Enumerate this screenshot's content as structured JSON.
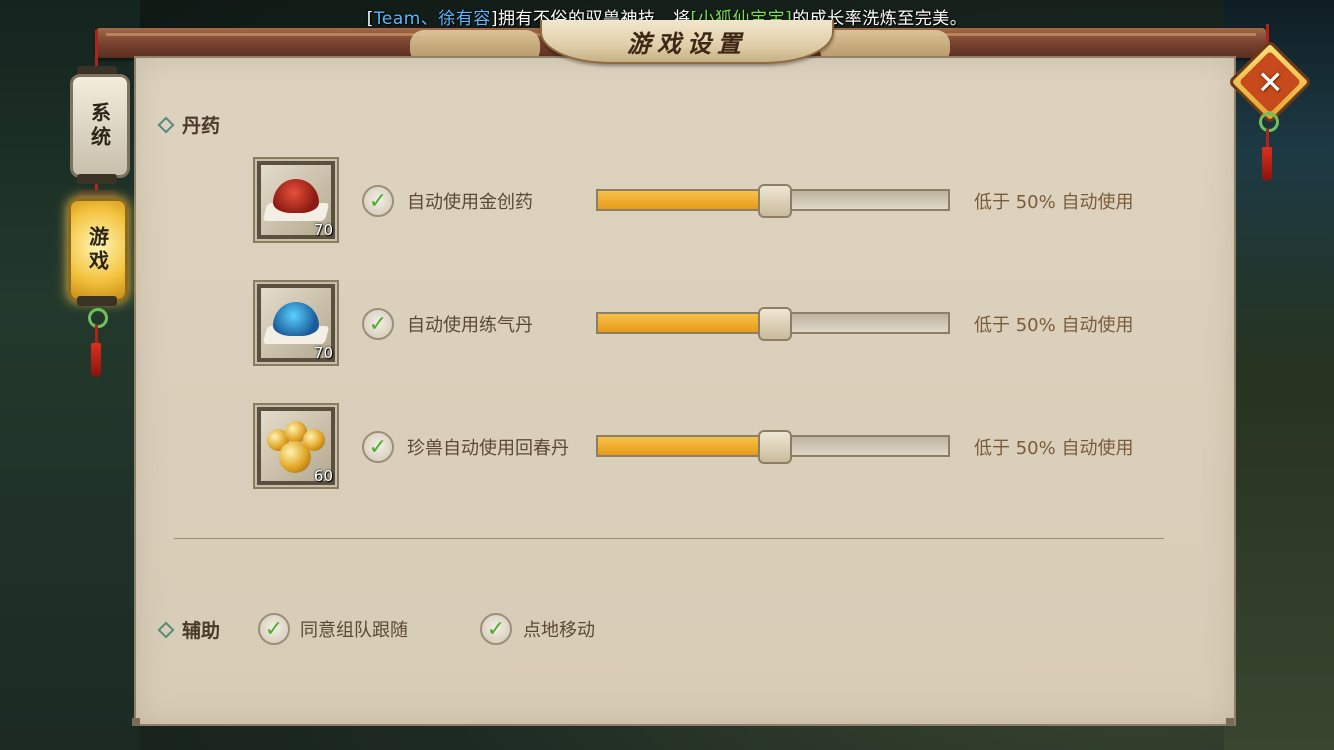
{
  "broadcast": {
    "open1": "[",
    "team": "Team、",
    "player": "徐有容",
    "close1": "]",
    "mid": "拥有不俗的驭兽神技，将",
    "open2": "[",
    "pet": "小狐仙宝宝",
    "close2": "]",
    "end": "的成长率洗炼至完美。"
  },
  "window": {
    "title": "游戏设置"
  },
  "tabs": [
    {
      "label": "系统",
      "active": false
    },
    {
      "label": "游戏",
      "active": true
    }
  ],
  "close_icon": "close-x-icon",
  "sections": {
    "medicine": {
      "label": "丹药",
      "rows": [
        {
          "item_icon": "red-powder-icon",
          "qty": "70",
          "checked": true,
          "label": "自动使用金创药",
          "slider_fraction": 0.5,
          "tail": "低于 50% 自动使用"
        },
        {
          "item_icon": "blue-powder-icon",
          "qty": "70",
          "checked": true,
          "label": "自动使用练气丹",
          "slider_fraction": 0.5,
          "tail": "低于 50% 自动使用"
        },
        {
          "item_icon": "golden-pills-icon",
          "qty": "60",
          "checked": true,
          "label": "珍兽自动使用回春丹",
          "slider_fraction": 0.5,
          "tail": "低于 50% 自动使用"
        }
      ]
    },
    "assist": {
      "label": "辅助",
      "options": [
        {
          "label": "同意组队跟随",
          "checked": true
        },
        {
          "label": "点地移动",
          "checked": true
        }
      ]
    }
  },
  "colors": {
    "accent_fill": "#e89a18",
    "check_green": "#4fae2f",
    "team_blue": "#5fb6ff",
    "pet_green": "#78e04a"
  }
}
